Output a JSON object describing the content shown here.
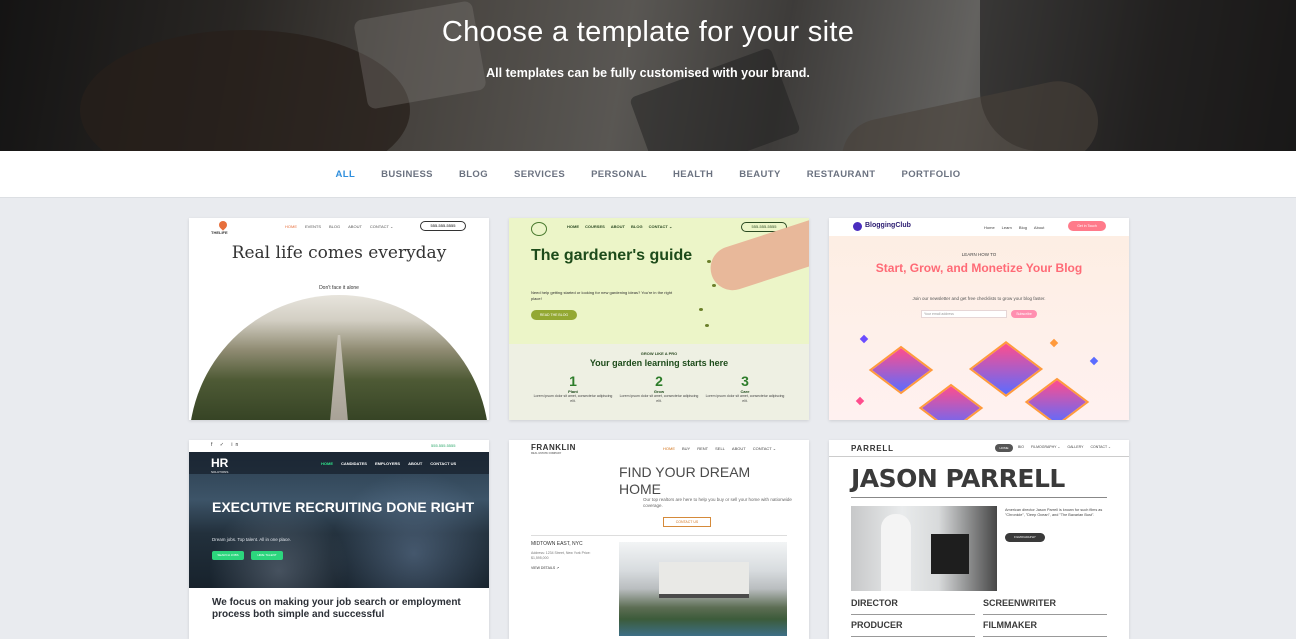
{
  "hero": {
    "title": "Choose a template for your site",
    "subtitle": "All templates can be fully customised with your brand."
  },
  "tabs": [
    {
      "label": "ALL",
      "active": true
    },
    {
      "label": "BUSINESS"
    },
    {
      "label": "BLOG"
    },
    {
      "label": "SERVICES"
    },
    {
      "label": "PERSONAL"
    },
    {
      "label": "HEALTH"
    },
    {
      "label": "BEAUTY"
    },
    {
      "label": "RESTAURANT"
    },
    {
      "label": "PORTFOLIO"
    }
  ],
  "colors": {
    "accent": "#2f8fdd",
    "page_bg": "#e9ebef"
  },
  "templates": {
    "thelife": {
      "logo": "THELIFE",
      "nav": [
        "HOME",
        "EVENTS",
        "BLOG",
        "ABOUT",
        "CONTACT ⌄"
      ],
      "phone": "555-555-5555",
      "title": "Real life comes everyday",
      "subtitle": "Don't face it alone"
    },
    "gardener": {
      "nav": [
        "HOME",
        "COURSES",
        "ABOUT",
        "BLOG",
        "CONTACT ⌄"
      ],
      "phone": "555-555-5555",
      "title": "The gardener's guide",
      "text": "Need help getting started or looking for new gardening ideas? You're in the right place!",
      "button": "READ THE BLOG",
      "kicker": "GROW LIKE A PRO",
      "section_title": "Your garden learning starts here",
      "steps": [
        {
          "num": "1",
          "label": "Plant",
          "desc": "Lorem ipsum dolor sit amet, consectetur adipiscing elit."
        },
        {
          "num": "2",
          "label": "Grow",
          "desc": "Lorem ipsum dolor sit amet, consectetur adipiscing elit."
        },
        {
          "num": "3",
          "label": "Care",
          "desc": "Lorem ipsum dolor sit amet, consectetur adipiscing elit."
        }
      ]
    },
    "blogging": {
      "logo": "BloggingClub",
      "nav": [
        "Home",
        "Learn",
        "Blog",
        "About"
      ],
      "cta": "Get in Touch",
      "kicker": "LEARN HOW TO",
      "title": "Start, Grow, and Monetize Your Blog",
      "subtitle": "Join our newsletter and get free checklists to grow your blog faster.",
      "input_placeholder": "Your email address",
      "submit": "Subscribe"
    },
    "hr": {
      "social": "f ✓ in",
      "phone": "555.555.5555",
      "logo": "HR",
      "logo_sub": "SOLUTIONS",
      "nav": [
        "HOME",
        "CANDIDATES",
        "EMPLOYERS",
        "ABOUT",
        "CONTACT US"
      ],
      "title": "EXECUTIVE RECRUITING DONE RIGHT",
      "subtitle": "Dream jobs. Top talent. All in one place.",
      "btn1": "SEARCH JOBS",
      "btn2": "HIRE TALENT",
      "body": "We focus on making your job search or employment process both simple and successful"
    },
    "franklin": {
      "logo": "FRANKLIN",
      "logo_sub": "REAL ESTATE COMPANY",
      "nav": [
        "HOME",
        "BUY",
        "RENT",
        "SELL",
        "ABOUT",
        "CONTACT ⌄"
      ],
      "title": "FIND YOUR DREAM HOME",
      "text": "Our top realtors are here to help you buy or sell your home with nationwide coverage.",
      "button": "CONTACT US",
      "location": "MIDTOWN EAST, NYC",
      "address": "Address: 1234 Street, New York Price: $1,595,000",
      "view": "VIEW DETAILS ↗"
    },
    "parrell": {
      "logo": "PARRELL",
      "pill": "HOME",
      "nav": [
        "BIO",
        "FILMOGRAPHY ⌄",
        "GALLERY",
        "CONTACT ⌄"
      ],
      "name": "JASON PARRELL",
      "bio": "American director Jason Parrell is known for such films as \"Chronicle\", \"Deep Ocean\", and \"The Bavarian Bust\".",
      "button": "FILMOGRAPHY",
      "roles": [
        "DIRECTOR",
        "SCREENWRITER",
        "PRODUCER",
        "FILMMAKER"
      ]
    }
  }
}
